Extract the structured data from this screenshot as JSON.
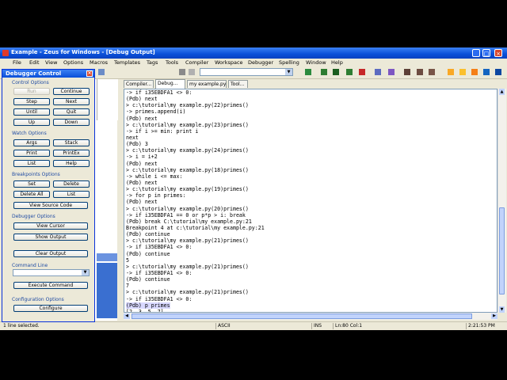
{
  "window": {
    "title": "Example - Zeus for Windows - [Debug Output]"
  },
  "menu": [
    "File",
    "Edit",
    "View",
    "Options",
    "Macros",
    "Templates",
    "Tags",
    "Tools",
    "Compiler",
    "Workspace",
    "Debugger",
    "Spelling",
    "Window",
    "Help"
  ],
  "tabs": [
    {
      "label": "Compiler..."
    },
    {
      "label": "Debug..."
    },
    {
      "label": "my example.py"
    },
    {
      "label": "Tool..."
    }
  ],
  "output_lines": [
    "-> if i35EBDFA1 <> 0:",
    "(Pdb) next",
    "> c:\\tutorial\\my example.py(22)primes()",
    "-> primes.append(i)",
    "(Pdb) next",
    "> c:\\tutorial\\my example.py(23)primes()",
    "-> if i >= min: print i",
    "next",
    "(Pdb) 3",
    "> c:\\tutorial\\my example.py(24)primes()",
    "-> i = i+2",
    "(Pdb) next",
    "> c:\\tutorial\\my example.py(18)primes()",
    "-> while i <= max:",
    "(Pdb) next",
    "> c:\\tutorial\\my example.py(19)primes()",
    "-> for p in primes:",
    "(Pdb) next",
    "> c:\\tutorial\\my example.py(20)primes()",
    "-> if i35EBDFA1 == 0 or p*p > i: break",
    "(Pdb) break C:\\tutorial\\my example.py:21",
    "Breakpoint 4 at c:\\tutorial\\my example.py:21",
    "(Pdb) continue",
    "> c:\\tutorial\\my example.py(21)primes()",
    "-> if i35EBDFA1 <> 0:",
    "(Pdb) continue",
    "5",
    "> c:\\tutorial\\my example.py(21)primes()",
    "-> if i35EBDFA1 <> 0:",
    "(Pdb) continue",
    "7",
    "> c:\\tutorial\\my example.py(21)primes()",
    "-> if i35EBDFA1 <> 0:",
    "(Pdb) p primes",
    "[2, 3, 5, 7]",
    "(Pdb)"
  ],
  "selected_line": 33,
  "status": {
    "left": "1 line selected.",
    "encoding": "ASCII",
    "mode": "INS",
    "position": "Ln:80 Col:1",
    "time": "2:21:53 PM"
  },
  "dialog": {
    "title": "Debugger Control",
    "groups": {
      "control": "Control Options",
      "watch": "Watch Options",
      "breakpoints": "Breakpoints Options",
      "debugger": "Debugger Options",
      "command": "Command Line",
      "config": "Configuration Options"
    },
    "buttons": {
      "run": "Run",
      "continue": "Continue",
      "step": "Step",
      "next": "Next",
      "until": "Until",
      "quit": "Quit",
      "up": "Up",
      "down": "Down",
      "args": "Args",
      "stack": "Stack",
      "print": "Print",
      "printex": "PrintEx",
      "list": "List",
      "help": "Help",
      "set": "Set",
      "delete": "Delete",
      "delete_all": "Delete All",
      "bp_list": "List",
      "view_source": "View Source Code",
      "view_cursor": "View Cursor",
      "show_output": "Show Output",
      "clear_output": "Clear Output",
      "execute": "Execute Command",
      "configure": "Configure"
    }
  }
}
